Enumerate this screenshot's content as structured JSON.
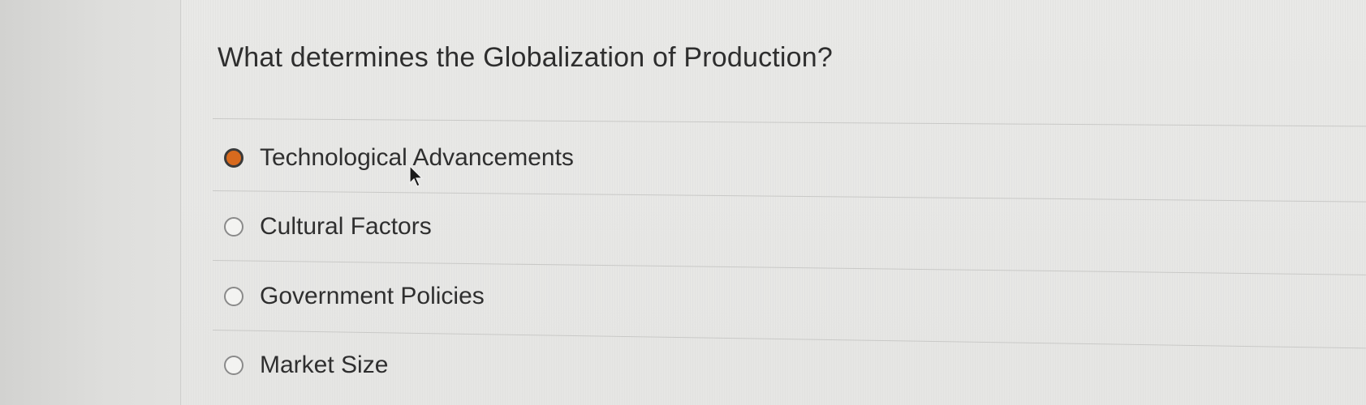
{
  "question": {
    "text": "What determines the Globalization of Production?"
  },
  "options": [
    {
      "label": "Technological Advancements",
      "selected": true
    },
    {
      "label": "Cultural Factors",
      "selected": false
    },
    {
      "label": "Government Policies",
      "selected": false
    },
    {
      "label": "Market Size",
      "selected": false
    }
  ],
  "colors": {
    "selected_fill": "#d86a1e",
    "text": "#2f2f2f",
    "background": "#e6e6e4"
  },
  "icons": {
    "cursor": "mouse-pointer-icon"
  }
}
